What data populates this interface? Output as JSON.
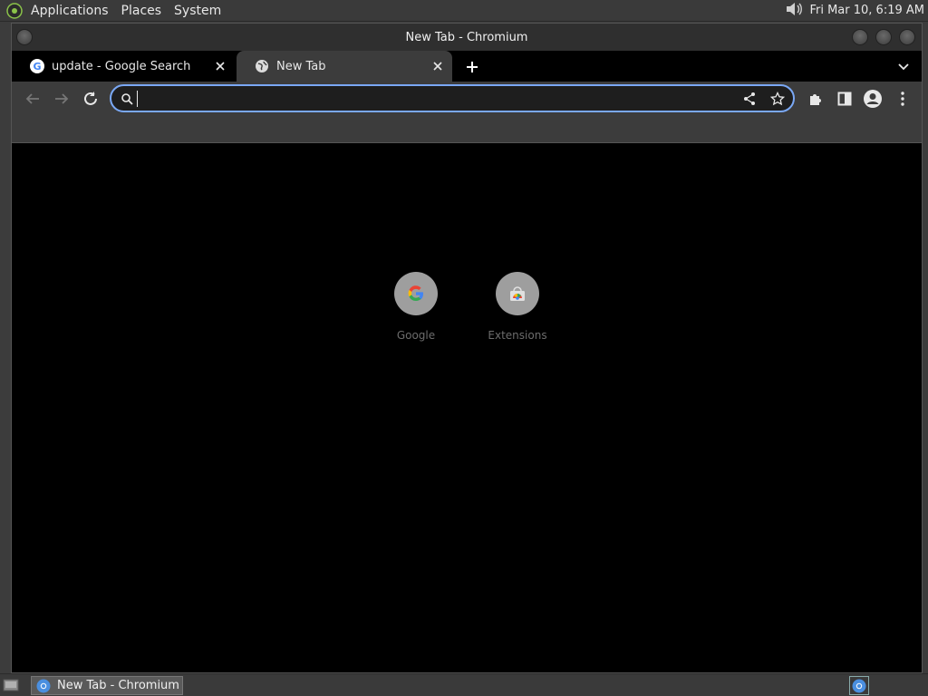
{
  "desktop": {
    "menus": [
      "Applications",
      "Places",
      "System"
    ],
    "clock": "Fri Mar 10,  6:19 AM"
  },
  "window": {
    "title": "New Tab - Chromium"
  },
  "tabs": [
    {
      "label": "update - Google Search",
      "favicon": "google-g-icon",
      "active": false
    },
    {
      "label": "New Tab",
      "favicon": "globe-icon",
      "active": true
    }
  ],
  "toolbar": {
    "address_value": "",
    "icons": [
      "back-arrow-icon",
      "forward-arrow-icon",
      "reload-icon",
      "search-icon",
      "share-icon",
      "star-icon",
      "extensions-puzzle-icon",
      "side-panel-icon",
      "profile-icon",
      "kebab-menu-icon"
    ]
  },
  "shortcuts": [
    {
      "label": "Google",
      "icon": "google-g-icon"
    },
    {
      "label": "Extensions",
      "icon": "chrome-web-store-icon"
    }
  ],
  "taskbar": {
    "task_label": "New Tab - Chromium"
  },
  "colors": {
    "accent": "#7aa8f5",
    "tab_active_bg": "#3c3c3c",
    "content_bg": "#000000"
  }
}
